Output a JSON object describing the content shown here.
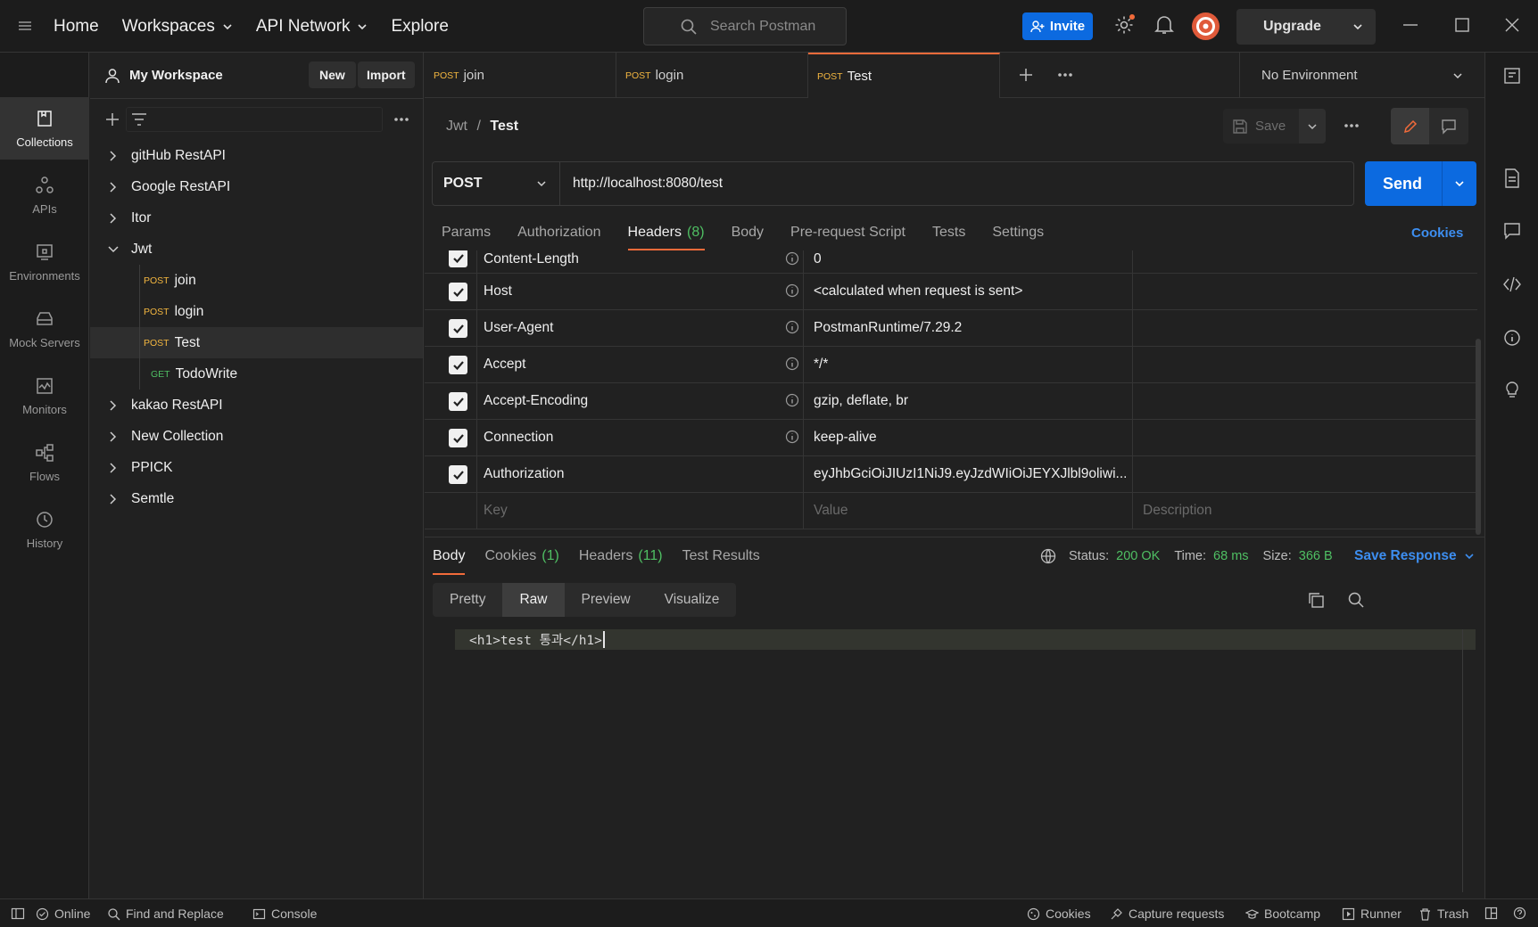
{
  "topnav": {
    "home": "Home",
    "workspaces": "Workspaces",
    "api_network": "API Network",
    "explore": "Explore"
  },
  "search": {
    "placeholder": "Search Postman"
  },
  "invite": "Invite",
  "upgrade": "Upgrade",
  "workspace": {
    "name": "My Workspace",
    "new": "New",
    "import": "Import"
  },
  "rail": [
    {
      "label": "Collections",
      "icon": "collections-icon"
    },
    {
      "label": "APIs",
      "icon": "apis-icon"
    },
    {
      "label": "Environments",
      "icon": "environments-icon"
    },
    {
      "label": "Mock Servers",
      "icon": "mock-servers-icon"
    },
    {
      "label": "Monitors",
      "icon": "monitors-icon"
    },
    {
      "label": "Flows",
      "icon": "flows-icon"
    },
    {
      "label": "History",
      "icon": "history-icon"
    }
  ],
  "collections": [
    {
      "name": "gitHub RestAPI"
    },
    {
      "name": "Google RestAPI"
    },
    {
      "name": "Itor"
    },
    {
      "name": "Jwt",
      "expanded": true,
      "requests": [
        {
          "method": "POST",
          "name": "join"
        },
        {
          "method": "POST",
          "name": "login"
        },
        {
          "method": "POST",
          "name": "Test",
          "selected": true
        },
        {
          "method": "GET",
          "name": "TodoWrite"
        }
      ]
    },
    {
      "name": "kakao RestAPI"
    },
    {
      "name": "New Collection"
    },
    {
      "name": "PPICK"
    },
    {
      "name": "Semtle"
    }
  ],
  "tabs": [
    {
      "method": "POST",
      "name": "join"
    },
    {
      "method": "POST",
      "name": "login"
    },
    {
      "method": "POST",
      "name": "Test",
      "active": true
    }
  ],
  "environment": "No Environment",
  "request": {
    "breadcrumb_parent": "Jwt",
    "breadcrumb_sep": "/",
    "breadcrumb_current": "Test",
    "save": "Save",
    "method": "POST",
    "url": "http://localhost:8080/test",
    "send": "Send",
    "tabs": [
      "Params",
      "Authorization",
      "Headers",
      "Body",
      "Pre-request Script",
      "Tests",
      "Settings"
    ],
    "headers_count": "(8)",
    "cookies": "Cookies"
  },
  "headers": [
    {
      "key": "Content-Length",
      "value": "0",
      "info": true
    },
    {
      "key": "Host",
      "value": "<calculated when request is sent>",
      "info": true
    },
    {
      "key": "User-Agent",
      "value": "PostmanRuntime/7.29.2",
      "info": true
    },
    {
      "key": "Accept",
      "value": "*/*",
      "info": true
    },
    {
      "key": "Accept-Encoding",
      "value": "gzip, deflate, br",
      "info": true
    },
    {
      "key": "Connection",
      "value": "keep-alive",
      "info": true
    },
    {
      "key": "Authorization",
      "value": "eyJhbGciOiJIUzI1NiJ9.eyJzdWIiOiJEYXJlbl9oliwi...",
      "info": false
    }
  ],
  "headers_placeholder": {
    "key": "Key",
    "value": "Value",
    "description": "Description"
  },
  "response": {
    "tabs": {
      "body": "Body",
      "cookies": "Cookies",
      "cookies_count": "(1)",
      "headers": "Headers",
      "headers_count": "(11)",
      "test_results": "Test Results"
    },
    "status_label": "Status:",
    "status": "200 OK",
    "time_label": "Time:",
    "time": "68 ms",
    "size_label": "Size:",
    "size": "366 B",
    "save_response": "Save Response",
    "view_modes": [
      "Pretty",
      "Raw",
      "Preview",
      "Visualize"
    ],
    "body": "<h1>test 통과</h1>"
  },
  "footer": {
    "online": "Online",
    "find_replace": "Find and Replace",
    "console": "Console",
    "cookies": "Cookies",
    "capture": "Capture requests",
    "bootcamp": "Bootcamp",
    "runner": "Runner",
    "trash": "Trash"
  },
  "colors": {
    "accent": "#f26b3a",
    "primary": "#0c6ae0",
    "post": "#f4b740",
    "get": "#4fbf63",
    "status_ok": "#4fbf63"
  }
}
